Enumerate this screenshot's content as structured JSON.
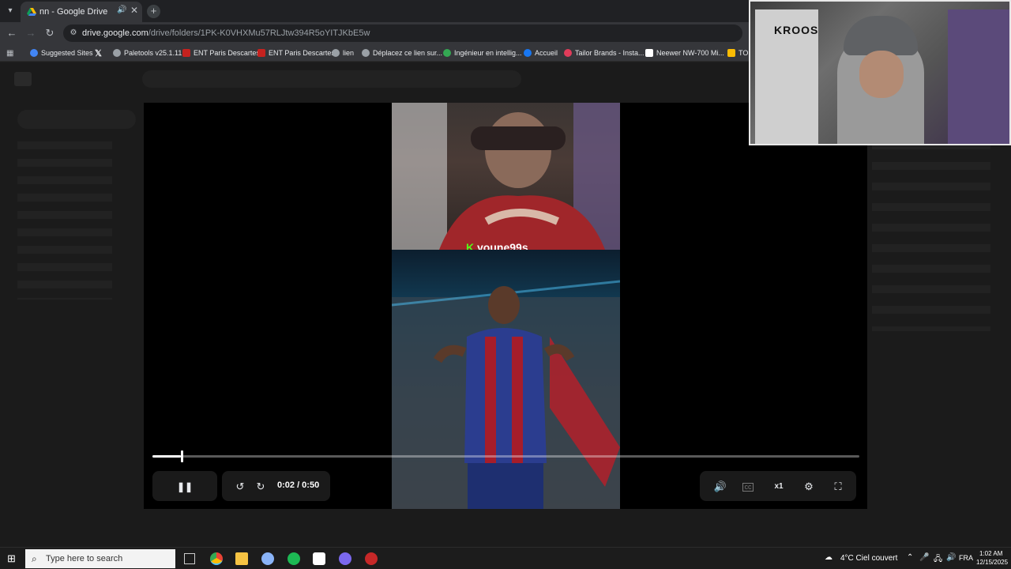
{
  "browser": {
    "tab": {
      "title": "nn - Google Drive"
    },
    "url": {
      "host": "drive.google.com",
      "path": "/drive/folders/1PK-K0VHXMu57RLJtw394R5oYITJKbE5w"
    },
    "bookmarks": [
      "Suggested Sites",
      "",
      "Paletools v25.1.11",
      "ENT Paris Descartes",
      "ENT Paris Descartes",
      "lien",
      "Déplacez ce lien sur...",
      "Ingénieur en intellig...",
      "Accueil",
      "Tailor Brands - Insta...",
      "Neewer NW-700 Mi...",
      "TON"
    ]
  },
  "video": {
    "overlay_username": "youne99s",
    "overlay_badge": "K",
    "time_display": "0:02 / 0:50",
    "progress_fraction": 0.04,
    "speed_label": "x1"
  },
  "webcam": {
    "jersey_text": "KROOS"
  },
  "taskbar": {
    "search_placeholder": "Type here to search",
    "weather": "4°C  Ciel couvert",
    "language": "FRA",
    "time": "1:02 AM",
    "date": "12/15/2025"
  },
  "colors": {
    "kick_green": "#53fc18",
    "chrome_dark": "#202124",
    "toolbar": "#35363a"
  }
}
